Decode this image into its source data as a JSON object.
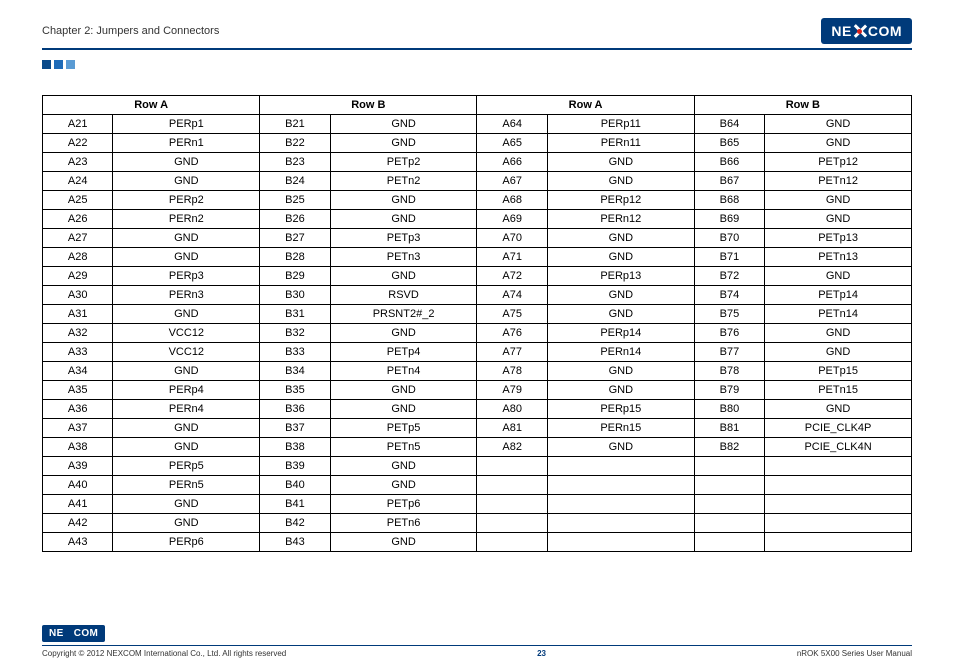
{
  "header": {
    "chapter": "Chapter 2: Jumpers and Connectors",
    "logo_left": "NE",
    "logo_right": "COM"
  },
  "table": {
    "headers": [
      "Row A",
      "Row B",
      "Row A",
      "Row B"
    ],
    "rows": [
      [
        "A21",
        "PERp1",
        "B21",
        "GND",
        "A64",
        "PERp11",
        "B64",
        "GND"
      ],
      [
        "A22",
        "PERn1",
        "B22",
        "GND",
        "A65",
        "PERn11",
        "B65",
        "GND"
      ],
      [
        "A23",
        "GND",
        "B23",
        "PETp2",
        "A66",
        "GND",
        "B66",
        "PETp12"
      ],
      [
        "A24",
        "GND",
        "B24",
        "PETn2",
        "A67",
        "GND",
        "B67",
        "PETn12"
      ],
      [
        "A25",
        "PERp2",
        "B25",
        "GND",
        "A68",
        "PERp12",
        "B68",
        "GND"
      ],
      [
        "A26",
        "PERn2",
        "B26",
        "GND",
        "A69",
        "PERn12",
        "B69",
        "GND"
      ],
      [
        "A27",
        "GND",
        "B27",
        "PETp3",
        "A70",
        "GND",
        "B70",
        "PETp13"
      ],
      [
        "A28",
        "GND",
        "B28",
        "PETn3",
        "A71",
        "GND",
        "B71",
        "PETn13"
      ],
      [
        "A29",
        "PERp3",
        "B29",
        "GND",
        "A72",
        "PERp13",
        "B72",
        "GND"
      ],
      [
        "A30",
        "PERn3",
        "B30",
        "RSVD",
        "A74",
        "GND",
        "B74",
        "PETp14"
      ],
      [
        "A31",
        "GND",
        "B31",
        "PRSNT2#_2",
        "A75",
        "GND",
        "B75",
        "PETn14"
      ],
      [
        "A32",
        "VCC12",
        "B32",
        "GND",
        "A76",
        "PERp14",
        "B76",
        "GND"
      ],
      [
        "A33",
        "VCC12",
        "B33",
        "PETp4",
        "A77",
        "PERn14",
        "B77",
        "GND"
      ],
      [
        "A34",
        "GND",
        "B34",
        "PETn4",
        "A78",
        "GND",
        "B78",
        "PETp15"
      ],
      [
        "A35",
        "PERp4",
        "B35",
        "GND",
        "A79",
        "GND",
        "B79",
        "PETn15"
      ],
      [
        "A36",
        "PERn4",
        "B36",
        "GND",
        "A80",
        "PERp15",
        "B80",
        "GND"
      ],
      [
        "A37",
        "GND",
        "B37",
        "PETp5",
        "A81",
        "PERn15",
        "B81",
        "PCIE_CLK4P"
      ],
      [
        "A38",
        "GND",
        "B38",
        "PETn5",
        "A82",
        "GND",
        "B82",
        "PCIE_CLK4N"
      ],
      [
        "A39",
        "PERp5",
        "B39",
        "GND",
        "",
        "",
        "",
        ""
      ],
      [
        "A40",
        "PERn5",
        "B40",
        "GND",
        "",
        "",
        "",
        ""
      ],
      [
        "A41",
        "GND",
        "B41",
        "PETp6",
        "",
        "",
        "",
        ""
      ],
      [
        "A42",
        "GND",
        "B42",
        "PETn6",
        "",
        "",
        "",
        ""
      ],
      [
        "A43",
        "PERp6",
        "B43",
        "GND",
        "",
        "",
        "",
        ""
      ]
    ],
    "gap_before_index": 14
  },
  "footer": {
    "copyright": "Copyright © 2012 NEXCOM International Co., Ltd. All rights reserved",
    "page": "23",
    "manual": "nROK 5X00 Series User Manual"
  }
}
